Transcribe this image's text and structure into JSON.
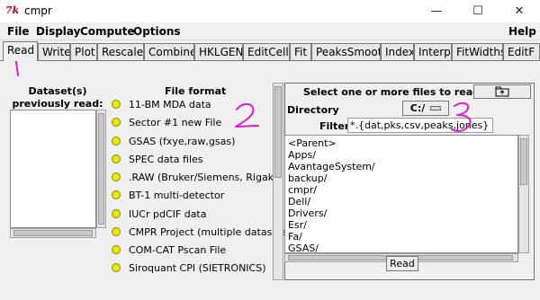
{
  "window": {
    "icon_glyph": "7k",
    "title": "cmpr",
    "minimize_glyph": "—",
    "maximize_glyph": "☐",
    "close_glyph": "✕"
  },
  "menu": {
    "items": [
      {
        "label": "File"
      },
      {
        "label": "Display"
      },
      {
        "label": "Compute"
      },
      {
        "label": "Options"
      }
    ],
    "help_label": "Help"
  },
  "tabs": [
    {
      "label": "Read",
      "active": true
    },
    {
      "label": "Write"
    },
    {
      "label": "Plot"
    },
    {
      "label": "Rescale"
    },
    {
      "label": "Combine"
    },
    {
      "label": "HKLGEN"
    },
    {
      "label": "EditCell"
    },
    {
      "label": "Fit"
    },
    {
      "label": "PeaksSmooth"
    },
    {
      "label": "Index"
    },
    {
      "label": "Interp"
    },
    {
      "label": "FitWidths"
    },
    {
      "label": "EditF"
    }
  ],
  "datasets": {
    "title_line1": "Dataset(s)",
    "title_line2": "previously read:",
    "items": []
  },
  "file_format": {
    "title": "File format",
    "options": [
      "11-BM MDA data",
      "Sector #1 new File",
      "GSAS (fxye,raw,gsas)",
      "SPEC data files",
      ".RAW (Bruker/Siemens, Rigaku)",
      "BT-1 multi-detector",
      "IUCr pdCIF data",
      "CMPR Project (multiple datasets)",
      "COM-CAT Pscan File",
      "Siroquant CPI (SIETRONICS)"
    ],
    "radio_color": "#e8e800"
  },
  "file_browser": {
    "title": "Select one or more files to read",
    "directory_label": "Directory",
    "directory_value": "C:/",
    "filter_label": "Filter",
    "filter_value": "*.{dat,pks,csv,peaks,jones}",
    "files": [
      "<Parent>",
      "Apps/",
      "AvantageSystem/",
      "backup/",
      "cmpr/",
      "Dell/",
      "Drivers/",
      "Esr/",
      "Fa/",
      "GSAS/"
    ],
    "read_label": "Read"
  },
  "annotations": {
    "color": "#e01fd0",
    "marks": [
      "1",
      "2",
      "3"
    ]
  }
}
